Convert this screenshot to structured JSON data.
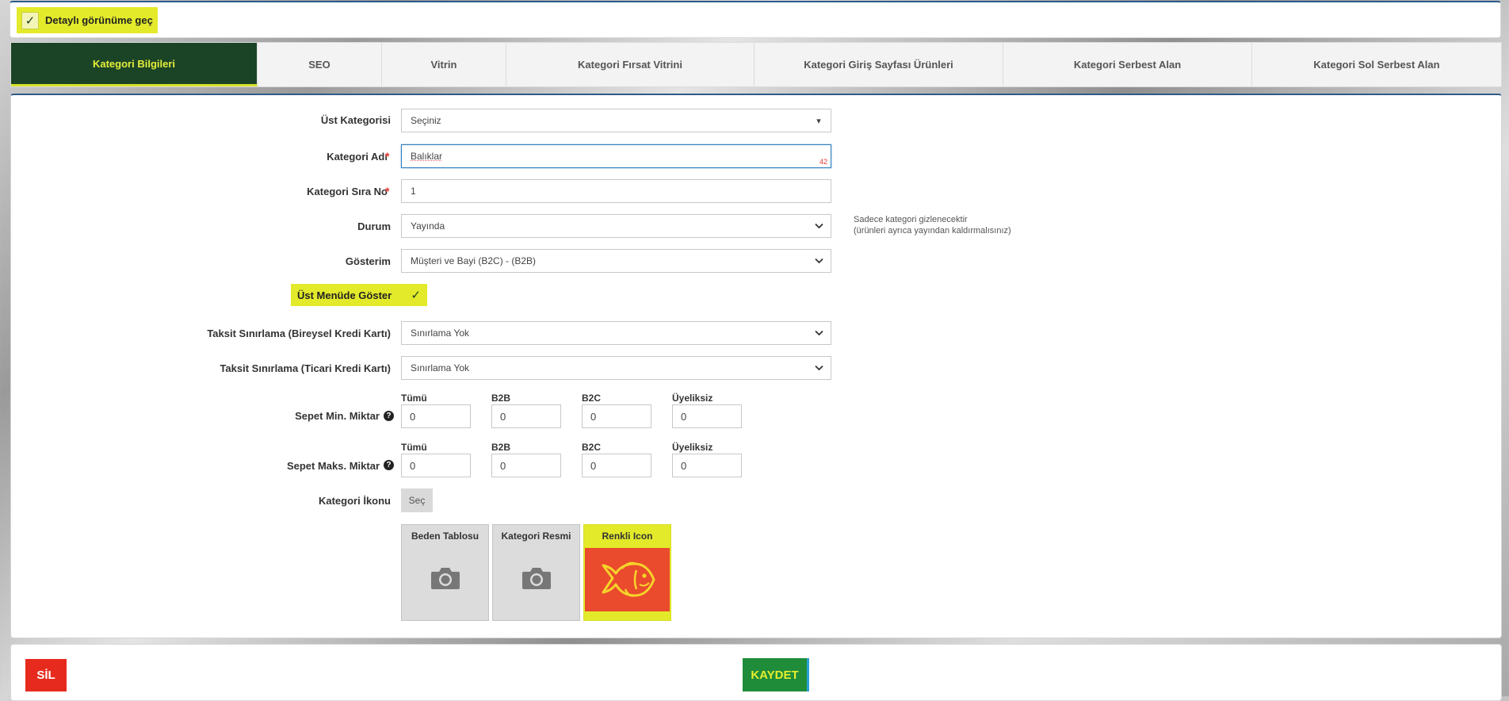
{
  "top": {
    "detail_toggle_label": "Detaylı görünüme geç",
    "detail_checked": true
  },
  "tabs": [
    {
      "label": "Kategori Bilgileri",
      "active": true
    },
    {
      "label": "SEO"
    },
    {
      "label": "Vitrin"
    },
    {
      "label": "Kategori Fırsat Vitrini"
    },
    {
      "label": "Kategori Giriş Sayfası Ürünleri"
    },
    {
      "label": "Kategori Serbest Alan"
    },
    {
      "label": "Kategori Sol Serbest Alan"
    }
  ],
  "form": {
    "parent_category": {
      "label": "Üst Kategorisi",
      "value": "Seçiniz"
    },
    "category_name": {
      "label": "Kategori Adı",
      "required": "*",
      "value": "Balıklar",
      "char_count": "42"
    },
    "sort_no": {
      "label": "Kategori Sıra No",
      "required": "*",
      "value": "1"
    },
    "status": {
      "label": "Durum",
      "value": "Yayında",
      "hint_line1": "Sadece kategori gizlenecektir",
      "hint_line2": "(ürünleri ayrıca yayından kaldırmalısınız)"
    },
    "display": {
      "label": "Gösterim",
      "value": "Müşteri ve Bayi (B2C) - (B2B)"
    },
    "show_top_menu": {
      "label": "Üst Menüde Göster",
      "checked": true
    },
    "installment_individual": {
      "label": "Taksit Sınırlama (Bireysel Kredi Kartı)",
      "value": "Sınırlama Yok"
    },
    "installment_commercial": {
      "label": "Taksit Sınırlama (Ticari Kredi Kartı)",
      "value": "Sınırlama Yok"
    },
    "basket_min": {
      "label": "Sepet Min. Miktar",
      "columns": [
        "Tümü",
        "B2B",
        "B2C",
        "Üyeliksiz"
      ],
      "values": [
        "0",
        "0",
        "0",
        "0"
      ]
    },
    "basket_max": {
      "label": "Sepet Maks. Miktar",
      "columns": [
        "Tümü",
        "B2B",
        "B2C",
        "Üyeliksiz"
      ],
      "values": [
        "0",
        "0",
        "0",
        "0"
      ]
    },
    "category_icon": {
      "label": "Kategori İkonu",
      "button": "Seç"
    },
    "images": [
      {
        "caption": "Beden Tablosu",
        "icon": "camera-icon"
      },
      {
        "caption": "Kategori Resmi",
        "icon": "camera-icon"
      },
      {
        "caption": "Renkli Icon",
        "icon": "fish-icon"
      }
    ]
  },
  "actions": {
    "delete": "SİL",
    "save": "KAYDET"
  },
  "colors": {
    "accent_yellow": "#e3ea2a",
    "tab_active_bg": "#1b4427",
    "save_green": "#1f8c3a",
    "delete_red": "#e62b1e",
    "fish_bg": "#e94b2c"
  }
}
